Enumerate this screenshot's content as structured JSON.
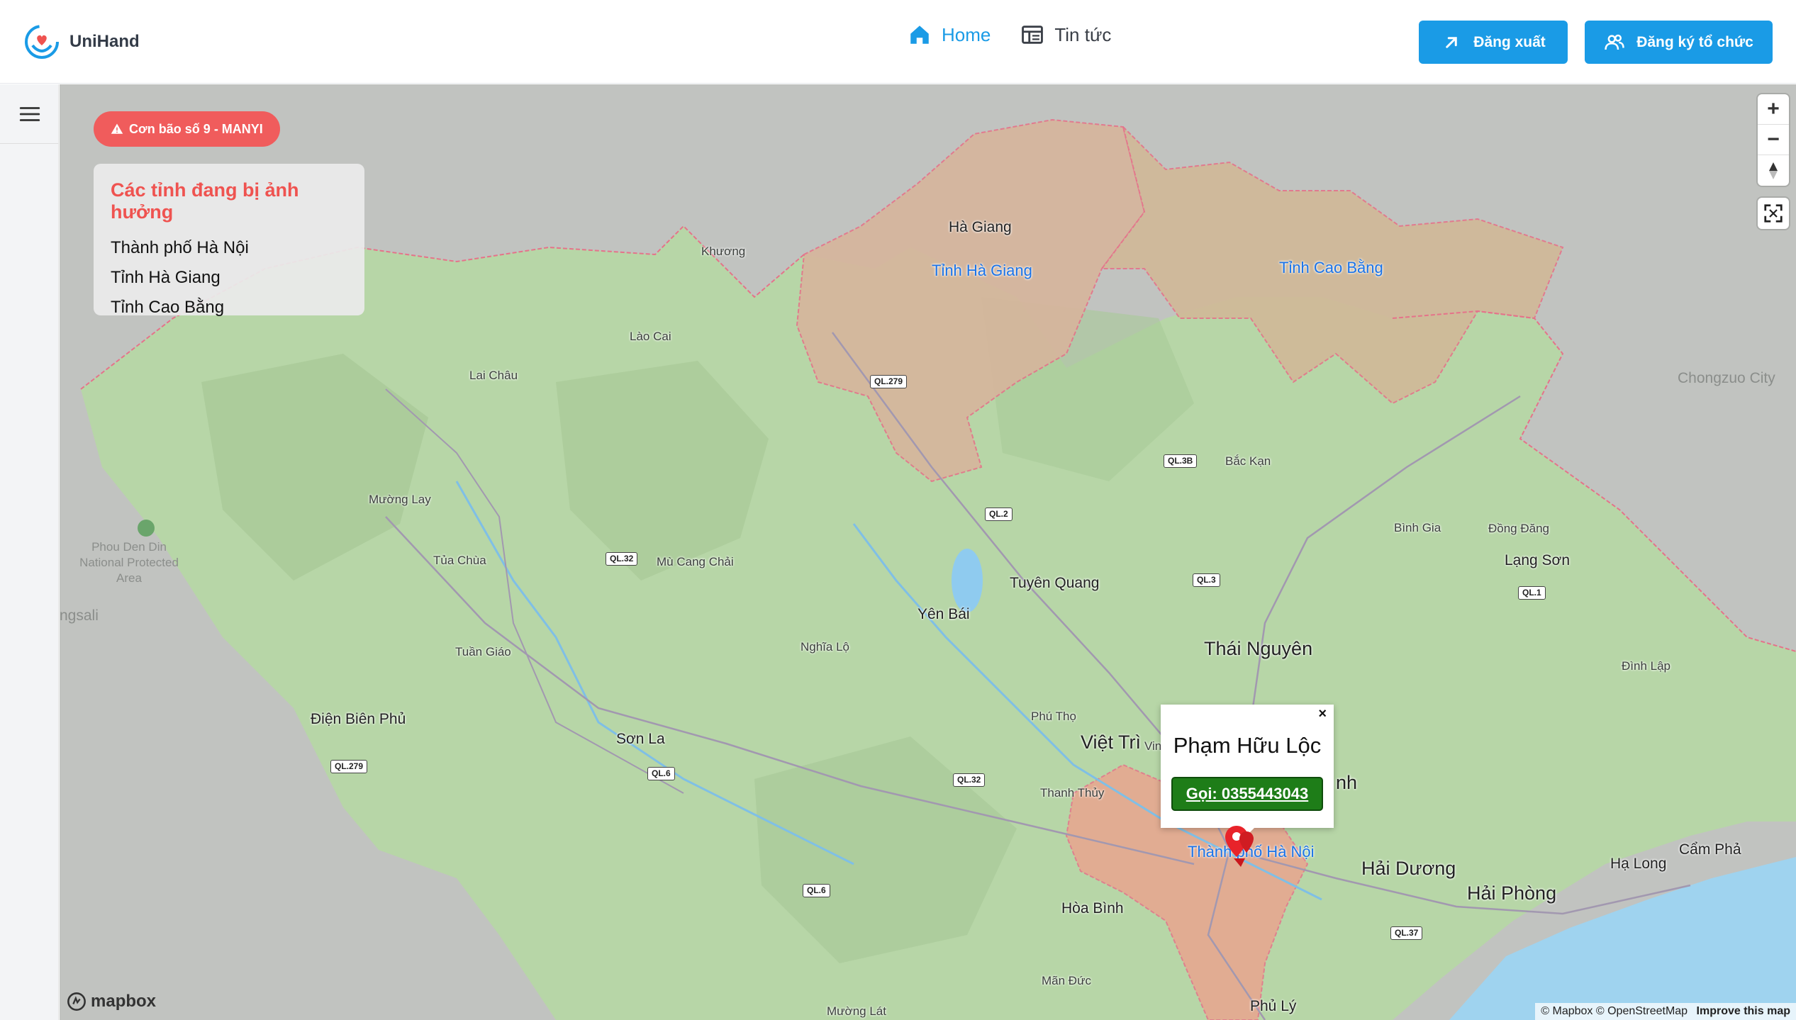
{
  "brand": {
    "name": "UniHand",
    "logo_icon": "hands-heart-icon"
  },
  "nav": {
    "home": {
      "label": "Home",
      "icon": "home-icon",
      "color": "#1a9be6"
    },
    "news": {
      "label": "Tin tức",
      "icon": "newspaper-icon"
    }
  },
  "actions": {
    "logout": {
      "label": "Đăng xuất",
      "icon": "arrow-up-right-icon"
    },
    "register_org": {
      "label": "Đăng ký tổ chức",
      "icon": "users-icon"
    }
  },
  "colors": {
    "primary": "#1a9be6",
    "danger": "#f05c5c",
    "call": "#1e7d18",
    "affected_fill": "#e6a08c"
  },
  "storm": {
    "label": "Cơn bão số 9 - MANYI",
    "icon": "warning-icon"
  },
  "affected": {
    "title": "Các tỉnh đang bị ảnh hưởng",
    "provinces": [
      "Thành phố Hà Nội",
      "Tỉnh Hà Giang",
      "Tỉnh Cao Bằng"
    ]
  },
  "map": {
    "province_labels": {
      "ha_giang": "Tỉnh Hà Giang",
      "cao_bang": "Tỉnh Cao Bằng",
      "ha_noi": "Thành phố Hà Nội"
    },
    "places": {
      "ha_giang": "Hà Giang",
      "lao_cai": "Lào Cai",
      "lai_chau": "Lai Châu",
      "muong_lay": "Mường Lay",
      "tua_chua": "Tủa Chùa",
      "mu_cang_chai": "Mù Cang Chải",
      "tuan_giao": "Tuần Giáo",
      "dien_bien_phu": "Điện Biên Phủ",
      "son_la": "Sơn La",
      "nghia_lo": "Nghĩa Lộ",
      "yen_bai": "Yên Bái",
      "tuyen_quang": "Tuyên Quang",
      "bac_kan": "Bắc Kạn",
      "thai_nguyen": "Thái Nguyên",
      "binh_gia": "Bình Gia",
      "dong_dang": "Đồng Đăng",
      "lang_son": "Lạng Sơn",
      "dinh_lap": "Đình Lập",
      "phu_tho": "Phú Thọ",
      "viet_tri": "Việt Trì",
      "thanh_thuy": "Thanh Thủy",
      "hoa_binh": "Hòa Bình",
      "hai_duong": "Hải Dương",
      "hai_phong": "Hải Phòng",
      "ha_long": "Hạ Long",
      "cam_pha": "Cẩm Phả",
      "phu_ly": "Phủ Lý",
      "man_duc": "Mãn Đức",
      "muong_lat": "Mường Lát",
      "chongzuo": "Chongzuo City",
      "phou_den_din": "Phou Den Din National Protected Area",
      "khuong": "Khương",
      "ngsali": "ngsali",
      "vin": "Vin",
      "nh": "nh"
    },
    "roads": [
      "QL.279",
      "QL.3B",
      "QL.2",
      "QL.32",
      "QL.3",
      "QL.1",
      "QL.279",
      "QL.6",
      "QL.32",
      "QL.6",
      "QL.37"
    ],
    "controls": {
      "zoom_in": "+",
      "zoom_out": "−",
      "compass": "compass-icon",
      "fullscreen": "fullscreen-icon"
    },
    "attribution": {
      "mapbox": "© Mapbox",
      "osm": "© OpenStreetMap",
      "improve": "Improve this map"
    },
    "logo": "mapbox"
  },
  "popup": {
    "name": "Phạm Hữu Lộc",
    "call_label": "Gọi: 0355443043",
    "close": "×"
  }
}
